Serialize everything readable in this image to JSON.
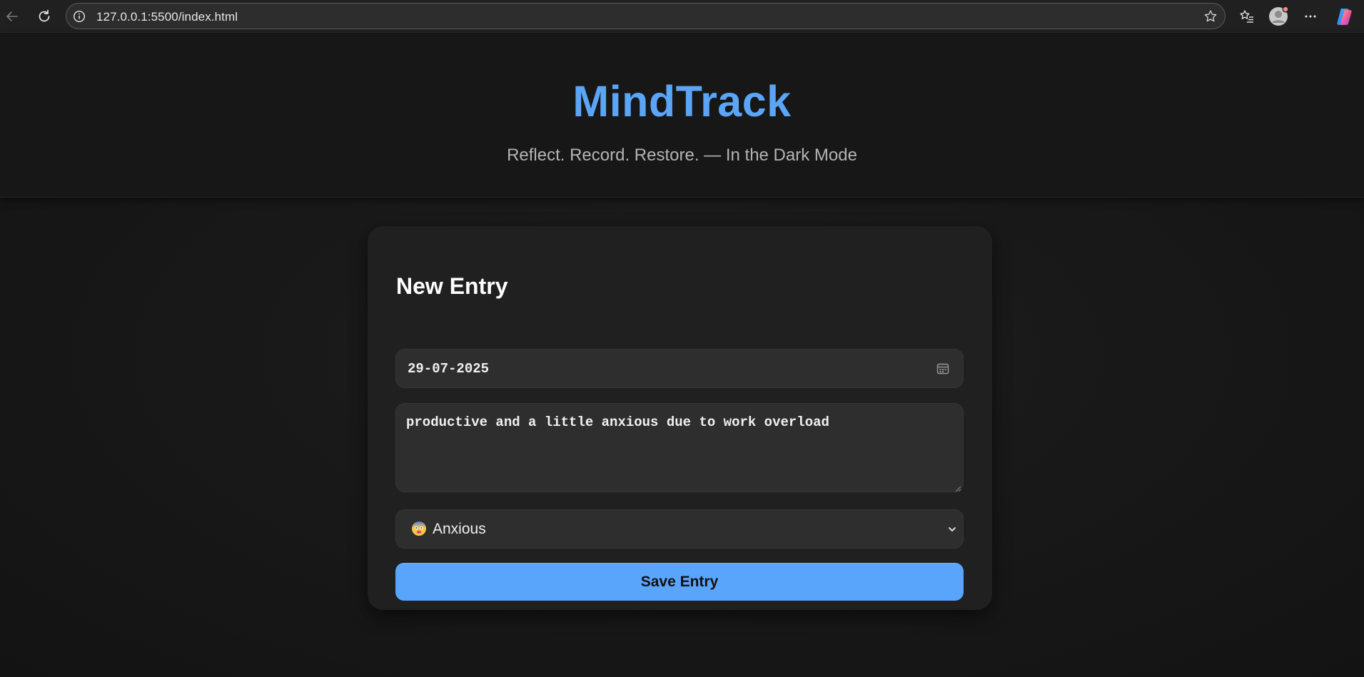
{
  "browser": {
    "url": "127.0.0.1:5500/index.html",
    "icons": [
      "back-arrow-icon",
      "refresh-icon",
      "site-info-icon",
      "favorite-star-icon",
      "favorites-icon",
      "profile-avatar-icon",
      "more-icon",
      "copilot-icon"
    ]
  },
  "header": {
    "title": "MindTrack",
    "tagline": "Reflect. Record. Restore. — In the Dark Mode"
  },
  "entry_form": {
    "heading": "New Entry",
    "date_value": "29-07-2025",
    "note_value": "productive and a little anxious due to work overload",
    "mood_selected": "Anxious",
    "mood_emoji_icon": "anxious-face-icon",
    "save_label": "Save Entry"
  },
  "colors": {
    "accent": "#5aa5f6",
    "button": "#5aa5fc",
    "card_bg": "#202020",
    "field_bg": "#2e2e2e",
    "page_bg": "#151515"
  }
}
